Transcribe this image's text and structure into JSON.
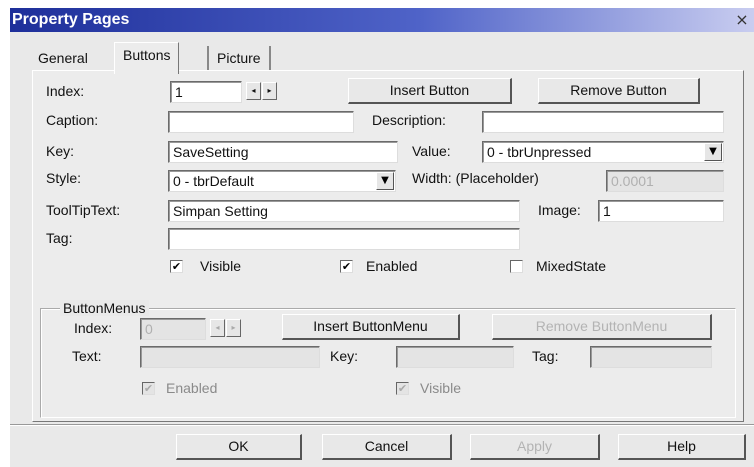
{
  "window": {
    "title": "Property Pages",
    "close_label": "×"
  },
  "tabs": [
    {
      "label": "General"
    },
    {
      "label": "Buttons"
    },
    {
      "label": "Picture"
    }
  ],
  "buttons_tab": {
    "index": {
      "label": "Index:",
      "value": "1"
    },
    "insert_button": "Insert Button",
    "remove_button": "Remove Button",
    "caption": {
      "label": "Caption:",
      "value": ""
    },
    "description": {
      "label": "Description:",
      "value": ""
    },
    "key": {
      "label": "Key:",
      "value": "SaveSetting"
    },
    "value": {
      "label": "Value:",
      "selected": "0 - tbrUnpressed"
    },
    "style": {
      "label": "Style:",
      "selected": "0 - tbrDefault"
    },
    "width": {
      "label": "Width: (Placeholder)",
      "value": "0.0001"
    },
    "tooltip": {
      "label": "ToolTipText:",
      "value": "Simpan Setting"
    },
    "image": {
      "label": "Image:",
      "value": "1"
    },
    "tag": {
      "label": "Tag:",
      "value": ""
    },
    "visible": {
      "label": "Visible",
      "checked": true
    },
    "enabled": {
      "label": "Enabled",
      "checked": true
    },
    "mixed_state": {
      "label": "MixedState",
      "checked": false
    }
  },
  "button_menus": {
    "title": "ButtonMenus",
    "index": {
      "label": "Index:",
      "value": "0"
    },
    "insert_label": "Insert ButtonMenu",
    "remove_label": "Remove ButtonMenu",
    "text": {
      "label": "Text:",
      "value": ""
    },
    "key": {
      "label": "Key:",
      "value": ""
    },
    "tag": {
      "label": "Tag:",
      "value": ""
    },
    "enabled": {
      "label": "Enabled",
      "checked": true
    },
    "visible": {
      "label": "Visible",
      "checked": true
    }
  },
  "footer": {
    "ok": "OK",
    "cancel": "Cancel",
    "apply": "Apply",
    "help": "Help"
  },
  "glyphs": {
    "check": "✔",
    "arrow_down": "▼",
    "arrow_left": "◂",
    "arrow_right": "▸"
  }
}
